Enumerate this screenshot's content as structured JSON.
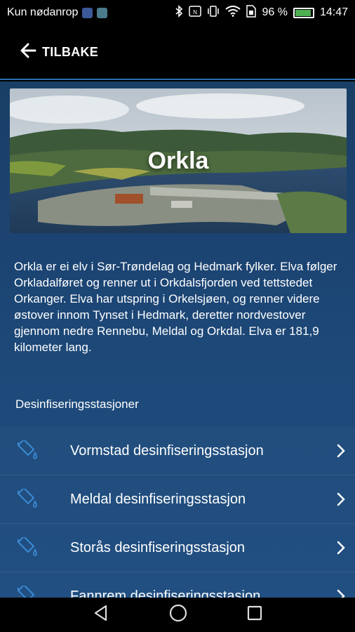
{
  "status_bar": {
    "carrier": "Kun nødanrop",
    "battery": "96 %",
    "time": "14:47"
  },
  "header": {
    "back_label": "TILBAKE"
  },
  "hero": {
    "title": "Orkla"
  },
  "description": "Orkla er ei elv i Sør-Trøndelag og Hedmark fylker. Elva følger Orkladalføret og renner ut i Orkdalsfjorden ved tettstedet Orkanger. Elva har utspring i Orkelsjøen, og renner videre østover innom Tynset i Hedmark, deretter nordvestover gjennom nedre Rennebu, Meldal og Orkdal. Elva er 181,9 kilometer lang.",
  "stations": {
    "heading": "Desinfiseringsstasjoner",
    "items": [
      {
        "label": "Vormstad desinfiseringsstasjon"
      },
      {
        "label": "Meldal desinfiseringsstasjon"
      },
      {
        "label": "Storås desinfiseringsstasjon"
      },
      {
        "label": "Fannrem desinfiseringsstasjon"
      }
    ]
  },
  "colors": {
    "accent": "#2a6fb0",
    "icon_blue": "#3a8ad4",
    "background_top": "#1a3f66",
    "background_bottom": "#1d4c7f"
  }
}
